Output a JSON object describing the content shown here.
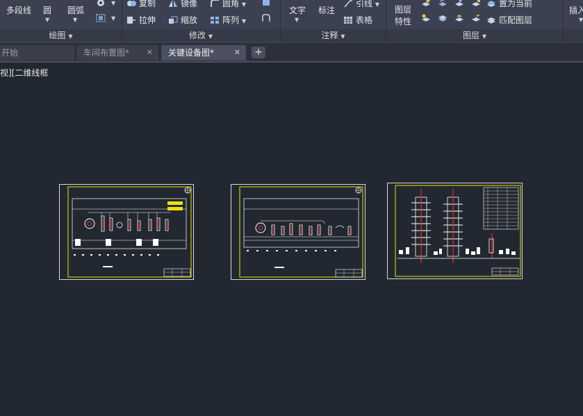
{
  "ribbon": {
    "draw_panel": {
      "polyline": "多段线",
      "circle": "圆",
      "arc": "圆弧",
      "title": "绘图"
    },
    "modify_panel": {
      "copy": "复制",
      "mirror": "镜像",
      "fillet": "圆角",
      "stretch": "拉伸",
      "scale": "缩放",
      "array": "阵列",
      "title": "修改"
    },
    "annotate_panel": {
      "text": "文字",
      "dimension": "标注",
      "leader": "引线",
      "table": "表格",
      "title": "注释"
    },
    "layers_panel": {
      "layer_properties_line1": "图层",
      "layer_properties_line2": "特性",
      "set_current": "置为当前",
      "match_layer": "匹配图层",
      "title": "图层"
    },
    "insert_panel": {
      "insert": "插入"
    }
  },
  "tabs": [
    {
      "label": "开始"
    },
    {
      "label": "车间布置图*"
    },
    {
      "label": "关键设备图*"
    }
  ],
  "add_tab_symbol": "+",
  "close_symbol": "✕",
  "viewport_label": "视][二维线框",
  "colors": {
    "background": "#222831",
    "ribbon": "#3b4150",
    "sheet_border": "#d8d8d8",
    "yellow_frame": "#e6e600",
    "red_marker": "#ff2020"
  }
}
